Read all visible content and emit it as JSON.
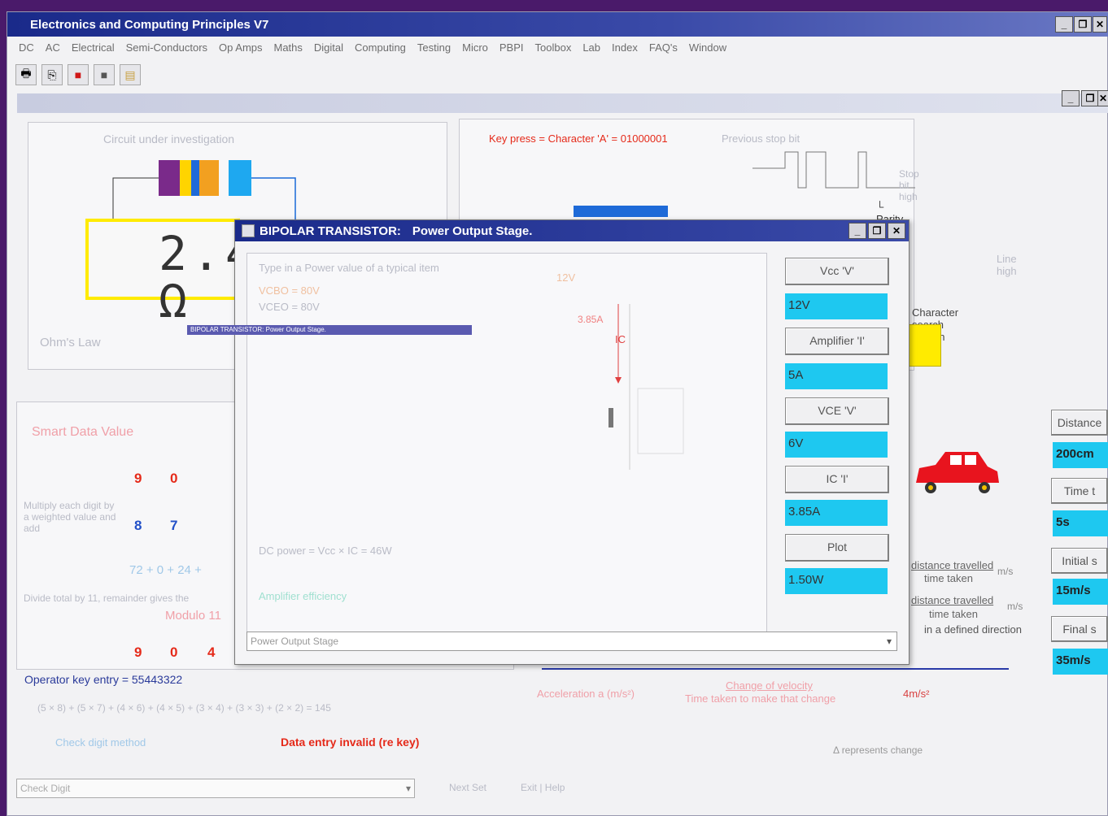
{
  "app": {
    "title": "Electronics and Computing Principles V7",
    "menu": [
      "DC",
      "AC",
      "Electrical",
      "Semi-Conductors",
      "Op Amps",
      "Maths",
      "Digital",
      "Computing",
      "Testing",
      "Micro",
      "PBPI",
      "Toolbox",
      "Lab",
      "Index",
      "FAQ's",
      "Window"
    ]
  },
  "window_buttons": {
    "minimize": "_",
    "restore": "❐",
    "close": "✕"
  },
  "toolbar": {
    "icons": [
      "printer-icon",
      "copy-icon",
      "book-icon",
      "stop-icon",
      "chart-icon"
    ]
  },
  "resistor_panel": {
    "title": "Circuit under investigation",
    "display_value": "2.4 Ω",
    "law_label": "Ohm's Law",
    "colors": {
      "band1": "#7a2a8a",
      "band2": "#ffd400",
      "band3": "#1e6ad8",
      "band4": "#f2a020",
      "outline": "#ffeb00",
      "wire": "#1a6ad8"
    }
  },
  "serial_panel": {
    "key_press": "Key press = Character 'A' = 01000001",
    "previous_stop": "Previous stop bit",
    "stop_bit_high": "Stop bit high",
    "parity_bit": "Parity bit",
    "char_search": "Character search pattern",
    "line_high": "Line high"
  },
  "modulo_panel": {
    "title": "Smart Data Value",
    "row1": [
      "9",
      "0"
    ],
    "row2": [
      "8",
      "7"
    ],
    "sum_row": "72 + 0 + 24 +",
    "left_label": "Multiply each digit by a weighted value and add",
    "divide_label": "Divide total by 11, remainder gives the",
    "modulo": "Modulo 11",
    "final": [
      "9",
      "0",
      "4"
    ],
    "operator_entry": "Operator key entry = 55443322",
    "formula": "(5 × 8) + (5 × 7) + (4 × 6) + (4 × 5) + (3 × 4) + (3 × 3) + (2 × 2) = 145",
    "check_digit": "Check digit method",
    "error": "Data entry invalid (re key)"
  },
  "motion_panel": {
    "labels": [
      "Distance",
      "Time t",
      "Initial s",
      "Final s"
    ],
    "values": [
      "200cm",
      "5s",
      "15m/s",
      "35m/s"
    ],
    "speed_formula_top": "distance travelled",
    "speed_formula_bottom": "time taken",
    "velocity_top": "distance travelled",
    "velocity_bottom": "time taken",
    "direction": "in a defined direction",
    "unit": "m/s",
    "accel_label": "Acceleration a (m/s²)",
    "accel_top": "Change of velocity",
    "accel_bottom": "Time taken to make that change",
    "accel_value": "4m/s²",
    "delta_note": "Δ represents change",
    "car_color": "#e8141e"
  },
  "dialog": {
    "title": "BIPOLAR TRANSISTOR:",
    "subtitle": "Power Output Stage.",
    "intro": "Type in a Power value of a typical item",
    "vcbo": "VCBO = 80V",
    "vceo": "VCEO = 80V",
    "mini_title": "BIPOLAR TRANSISTOR:  Power Output Stage.",
    "ic_label": "IC",
    "ic_value": "3.85A",
    "supply": "12V",
    "dc_power": "DC power = Vcc × IC = 46W",
    "efficiency": "Amplifier efficiency",
    "dropdown": "Power Output Stage",
    "buttons": [
      "Vcc 'V'",
      "Amplifier 'I'",
      "VCE 'V'",
      "IC 'I'",
      "Plot"
    ],
    "values": [
      "12V",
      "5A",
      "6V",
      "3.85A",
      "1.50W"
    ]
  },
  "bottom_bar": {
    "check_digit": "Check Digit",
    "next": "Next Set",
    "exit": "Exit | Help"
  }
}
